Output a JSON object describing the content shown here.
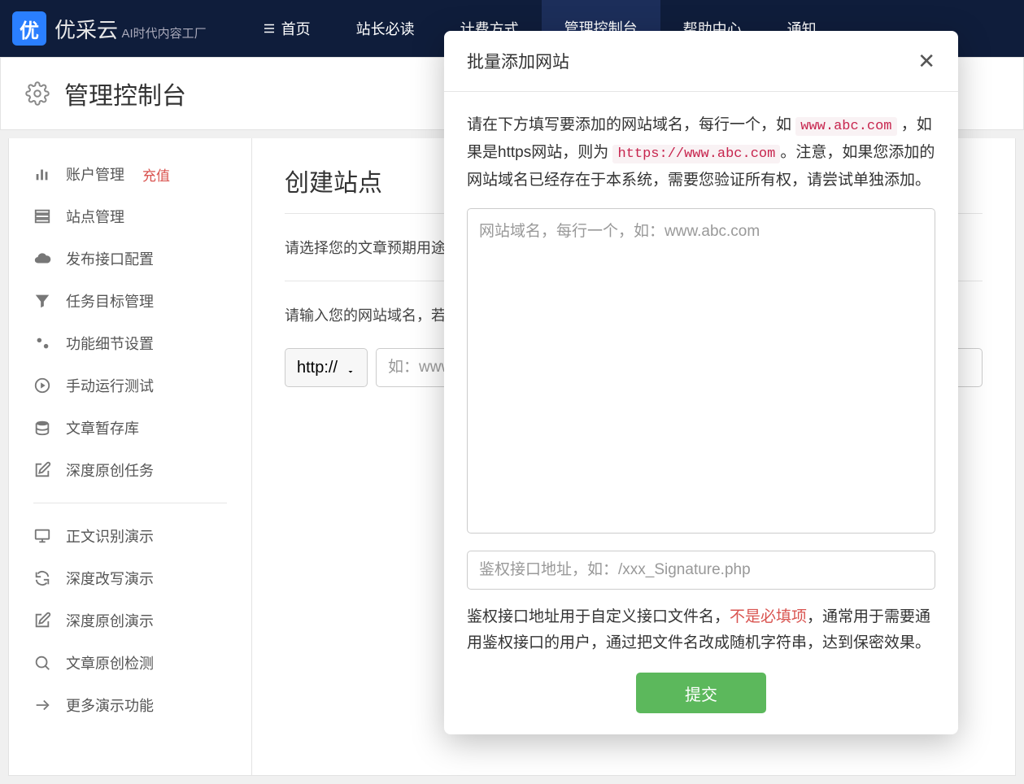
{
  "brand": {
    "mark": "优",
    "name": "优采云",
    "tagline": "AI时代内容工厂"
  },
  "nav": {
    "home": "首页",
    "webmaster": "站长必读",
    "pricing": "计费方式",
    "console": "管理控制台",
    "help": "帮助中心",
    "notify": "通知"
  },
  "page": {
    "title": "管理控制台"
  },
  "sidebar": {
    "account": "账户管理",
    "recharge": "充值",
    "sites": "站点管理",
    "publish": "发布接口配置",
    "tasks": "任务目标管理",
    "settings": "功能细节设置",
    "manual": "手动运行测试",
    "storage": "文章暂存库",
    "deep_original": "深度原创任务",
    "body_demo": "正文识别演示",
    "rewrite_demo": "深度改写演示",
    "original_demo": "深度原创演示",
    "detect": "文章原创检测",
    "more": "更多演示功能"
  },
  "main": {
    "heading": "创建站点",
    "usage_hint": "请选择您的文章预期用途",
    "domain_hint": "请输入您的网站域名，若",
    "protocol": "http://",
    "domain_placeholder": "如：www"
  },
  "modal": {
    "title": "批量添加网站",
    "desc_1": "请在下方填写要添加的网站域名，每行一个，如 ",
    "code_1": "www.abc.com",
    "desc_2": " ，如果是https网站，则为 ",
    "code_2": "https://www.abc.com",
    "desc_3": "。注意，如果您添加的网站域名已经存在于本系统，需要您验证所有权，请尝试单独添加。",
    "textarea_placeholder": "网站域名，每行一个，如：www.abc.com",
    "auth_placeholder": "鉴权接口地址，如：/xxx_Signature.php",
    "note_1": "鉴权接口地址用于自定义接口文件名，",
    "note_optional": "不是必填项",
    "note_2": "，通常用于需要通用鉴权接口的用户，通过把文件名改成随机字符串，达到保密效果。",
    "submit": "提交"
  }
}
